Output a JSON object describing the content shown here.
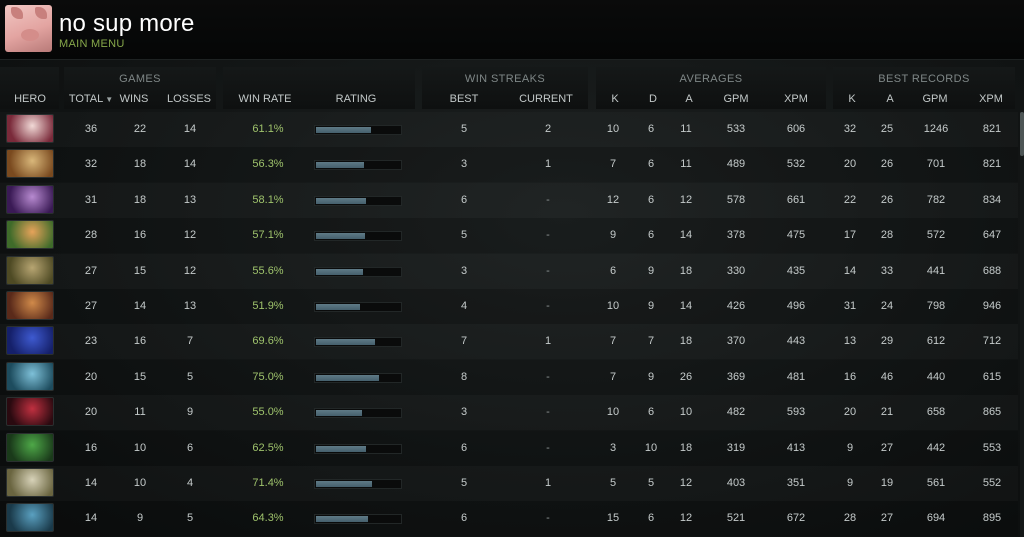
{
  "header": {
    "title": "no sup more",
    "menu_link": "MAIN MENU"
  },
  "groups": {
    "games": "GAMES",
    "win_streaks": "WIN STREAKS",
    "averages": "AVERAGES",
    "best_records": "BEST RECORDS"
  },
  "columns": {
    "hero": "HERO",
    "total": "TOTAL",
    "wins": "WINS",
    "losses": "LOSSES",
    "win_rate": "WIN RATE",
    "rating": "RATING",
    "best": "BEST",
    "current": "CURRENT",
    "avg_k": "K",
    "avg_d": "D",
    "avg_a": "A",
    "avg_gpm": "GPM",
    "avg_xpm": "XPM",
    "best_k": "K",
    "best_a": "A",
    "best_gpm": "GPM",
    "best_xpm": "XPM"
  },
  "sort_icon": "chevron-down-icon",
  "colors": {
    "win_rate_high": "#9fc36c",
    "rating_bar": "#55707d",
    "accent_link": "#86a84a"
  },
  "rows": [
    {
      "hero_icon": "hero-portrait-1",
      "total": "36",
      "wins": "22",
      "losses": "14",
      "win_rate": "61.1%",
      "rating": 0.65,
      "best": "5",
      "current": "2",
      "avg_k": "10",
      "avg_d": "6",
      "avg_a": "11",
      "avg_gpm": "533",
      "avg_xpm": "606",
      "best_k": "32",
      "best_a": "25",
      "best_gpm": "1246",
      "best_xpm": "821"
    },
    {
      "hero_icon": "hero-portrait-2",
      "total": "32",
      "wins": "18",
      "losses": "14",
      "win_rate": "56.3%",
      "rating": 0.57,
      "best": "3",
      "current": "1",
      "avg_k": "7",
      "avg_d": "6",
      "avg_a": "11",
      "avg_gpm": "489",
      "avg_xpm": "532",
      "best_k": "20",
      "best_a": "26",
      "best_gpm": "701",
      "best_xpm": "821"
    },
    {
      "hero_icon": "hero-portrait-3",
      "total": "31",
      "wins": "18",
      "losses": "13",
      "win_rate": "58.1%",
      "rating": 0.6,
      "best": "6",
      "current": "-",
      "avg_k": "12",
      "avg_d": "6",
      "avg_a": "12",
      "avg_gpm": "578",
      "avg_xpm": "661",
      "best_k": "22",
      "best_a": "26",
      "best_gpm": "782",
      "best_xpm": "834"
    },
    {
      "hero_icon": "hero-portrait-4",
      "total": "28",
      "wins": "16",
      "losses": "12",
      "win_rate": "57.1%",
      "rating": 0.58,
      "best": "5",
      "current": "-",
      "avg_k": "9",
      "avg_d": "6",
      "avg_a": "14",
      "avg_gpm": "378",
      "avg_xpm": "475",
      "best_k": "17",
      "best_a": "28",
      "best_gpm": "572",
      "best_xpm": "647"
    },
    {
      "hero_icon": "hero-portrait-5",
      "total": "27",
      "wins": "15",
      "losses": "12",
      "win_rate": "55.6%",
      "rating": 0.56,
      "best": "3",
      "current": "-",
      "avg_k": "6",
      "avg_d": "9",
      "avg_a": "18",
      "avg_gpm": "330",
      "avg_xpm": "435",
      "best_k": "14",
      "best_a": "33",
      "best_gpm": "441",
      "best_xpm": "688"
    },
    {
      "hero_icon": "hero-portrait-6",
      "total": "27",
      "wins": "14",
      "losses": "13",
      "win_rate": "51.9%",
      "rating": 0.52,
      "best": "4",
      "current": "-",
      "avg_k": "10",
      "avg_d": "9",
      "avg_a": "14",
      "avg_gpm": "426",
      "avg_xpm": "496",
      "best_k": "31",
      "best_a": "24",
      "best_gpm": "798",
      "best_xpm": "946"
    },
    {
      "hero_icon": "hero-portrait-7",
      "total": "23",
      "wins": "16",
      "losses": "7",
      "win_rate": "69.6%",
      "rating": 0.7,
      "best": "7",
      "current": "1",
      "avg_k": "7",
      "avg_d": "7",
      "avg_a": "18",
      "avg_gpm": "370",
      "avg_xpm": "443",
      "best_k": "13",
      "best_a": "29",
      "best_gpm": "612",
      "best_xpm": "712"
    },
    {
      "hero_icon": "hero-portrait-8",
      "total": "20",
      "wins": "15",
      "losses": "5",
      "win_rate": "75.0%",
      "rating": 0.75,
      "best": "8",
      "current": "-",
      "avg_k": "7",
      "avg_d": "9",
      "avg_a": "26",
      "avg_gpm": "369",
      "avg_xpm": "481",
      "best_k": "16",
      "best_a": "46",
      "best_gpm": "440",
      "best_xpm": "615"
    },
    {
      "hero_icon": "hero-portrait-9",
      "total": "20",
      "wins": "11",
      "losses": "9",
      "win_rate": "55.0%",
      "rating": 0.55,
      "best": "3",
      "current": "-",
      "avg_k": "10",
      "avg_d": "6",
      "avg_a": "10",
      "avg_gpm": "482",
      "avg_xpm": "593",
      "best_k": "20",
      "best_a": "21",
      "best_gpm": "658",
      "best_xpm": "865"
    },
    {
      "hero_icon": "hero-portrait-10",
      "total": "16",
      "wins": "10",
      "losses": "6",
      "win_rate": "62.5%",
      "rating": 0.6,
      "best": "6",
      "current": "-",
      "avg_k": "3",
      "avg_d": "10",
      "avg_a": "18",
      "avg_gpm": "319",
      "avg_xpm": "413",
      "best_k": "9",
      "best_a": "27",
      "best_gpm": "442",
      "best_xpm": "553"
    },
    {
      "hero_icon": "hero-portrait-11",
      "total": "14",
      "wins": "10",
      "losses": "4",
      "win_rate": "71.4%",
      "rating": 0.67,
      "best": "5",
      "current": "1",
      "avg_k": "5",
      "avg_d": "5",
      "avg_a": "12",
      "avg_gpm": "403",
      "avg_xpm": "351",
      "best_k": "9",
      "best_a": "19",
      "best_gpm": "561",
      "best_xpm": "552"
    },
    {
      "hero_icon": "hero-portrait-12",
      "total": "14",
      "wins": "9",
      "losses": "5",
      "win_rate": "64.3%",
      "rating": 0.62,
      "best": "6",
      "current": "-",
      "avg_k": "15",
      "avg_d": "6",
      "avg_a": "12",
      "avg_gpm": "521",
      "avg_xpm": "672",
      "best_k": "28",
      "best_a": "27",
      "best_gpm": "694",
      "best_xpm": "895"
    }
  ]
}
